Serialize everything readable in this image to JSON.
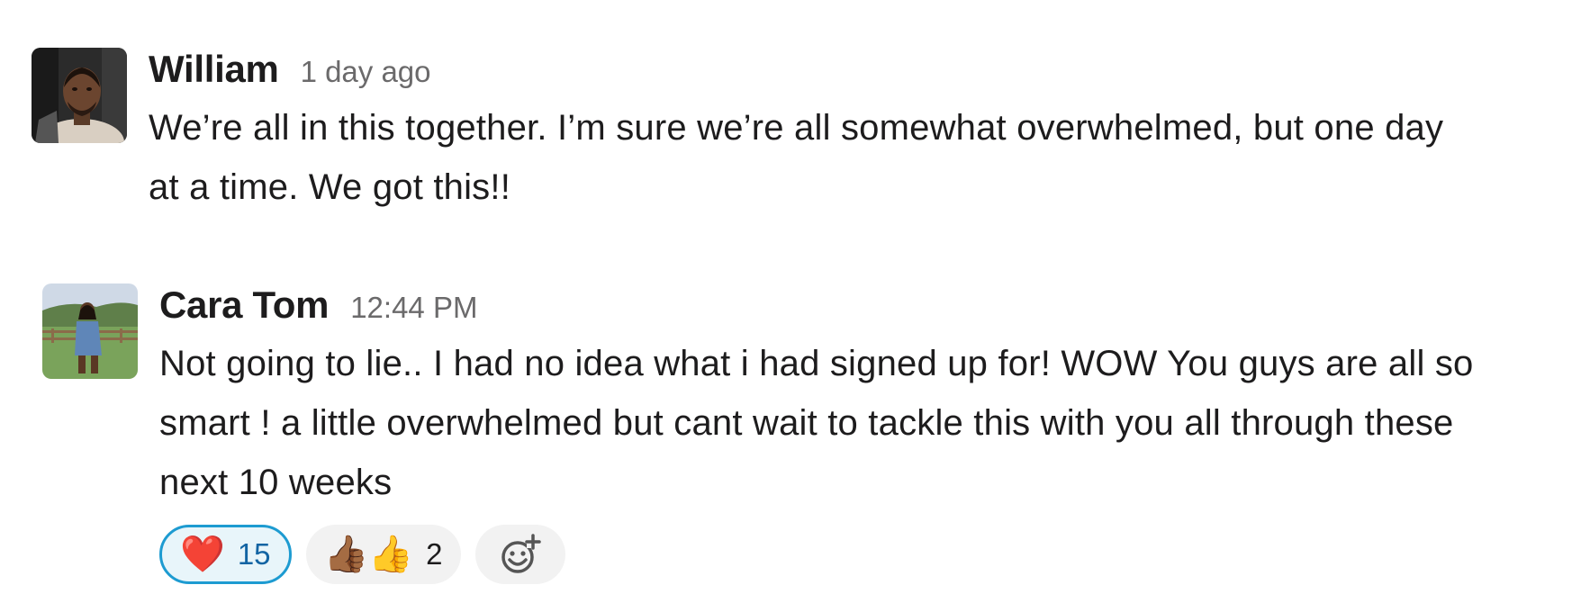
{
  "messages": [
    {
      "author": "William",
      "time": "1 day ago",
      "text": "We’re all in this together. I’m sure we’re all somewhat overwhelmed, but one day at a time. We got this!!"
    },
    {
      "author": "Cara Tom",
      "time": "12:44 PM",
      "text": "Not going to lie.. I had no idea what i had signed up for! WOW You guys are all so smart ! a little overwhelmed but cant wait to tackle this with you all through these next 10 weeks",
      "reactions": [
        {
          "emoji": "❤️",
          "count": "15",
          "selected": true
        },
        {
          "emoji": "👍🏾👍",
          "count": "2",
          "selected": false
        }
      ]
    }
  ],
  "colors": {
    "accent": "#1d9bd1",
    "text": "#1d1c1d",
    "muted": "#6b6a6b",
    "reaction_bg": "#f2f2f2"
  },
  "icons": {
    "add_reaction": "add-reaction-icon"
  }
}
